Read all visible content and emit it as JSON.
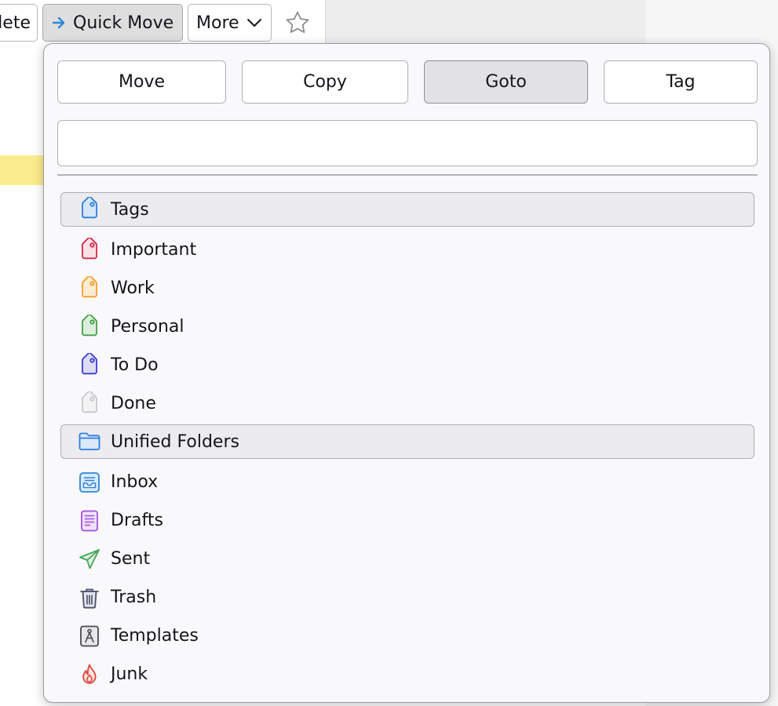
{
  "toolbar": {
    "delete_label": "lete",
    "quick_move_label": "Quick Move",
    "more_label": "More"
  },
  "popup": {
    "modes": [
      "Move",
      "Copy",
      "Goto",
      "Tag"
    ],
    "selected_mode": "Goto",
    "search": {
      "value": "",
      "placeholder": ""
    },
    "sections": [
      {
        "header": "Tags",
        "header_icon": "tag-icon",
        "items": [
          {
            "label": "Important",
            "icon": "tag-icon",
            "color": "#d7264b"
          },
          {
            "label": "Work",
            "icon": "tag-icon",
            "color": "#f59d2a"
          },
          {
            "label": "Personal",
            "icon": "tag-icon",
            "color": "#43a046"
          },
          {
            "label": "To Do",
            "icon": "tag-icon",
            "color": "#3b3bd4"
          },
          {
            "label": "Done",
            "icon": "tag-icon",
            "color": "#c8c8cc"
          }
        ]
      },
      {
        "header": "Unified Folders",
        "header_icon": "folder-icon",
        "items": [
          {
            "label": "Inbox",
            "icon": "inbox-icon",
            "color": "#2f86d8"
          },
          {
            "label": "Drafts",
            "icon": "drafts-icon",
            "color": "#a34fe0"
          },
          {
            "label": "Sent",
            "icon": "sent-icon",
            "color": "#45a35a"
          },
          {
            "label": "Trash",
            "icon": "trash-icon",
            "color": "#4a4f6a"
          },
          {
            "label": "Templates",
            "icon": "templates-icon",
            "color": "#4a4a52"
          },
          {
            "label": "Junk",
            "icon": "junk-icon",
            "color": "#e0453a"
          }
        ]
      }
    ]
  },
  "colors": {
    "accent_blue": "#2f86d8",
    "tag_header_blue": "#2f7de0",
    "selected_button_bg": "#e2e2e4",
    "highlight_yellow": "#fbec8e"
  }
}
